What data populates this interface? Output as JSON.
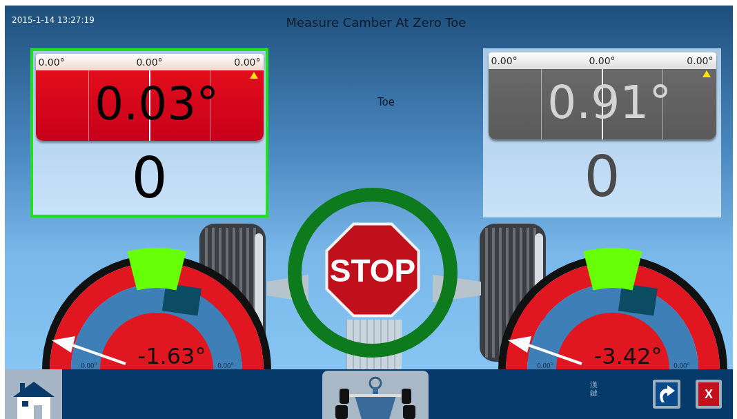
{
  "timestamp": "2015-1-14 13:27:19",
  "title": "Measure Camber At Zero Toe",
  "center_label": "Toe",
  "toe_panels": [
    {
      "selected": true,
      "active": true,
      "scale": [
        "0.00°",
        "0.00°",
        "0.00°"
      ],
      "reading": "0.03°",
      "count": "0"
    },
    {
      "selected": false,
      "active": false,
      "scale": [
        "0.00°",
        "0.00°",
        "0.00°"
      ],
      "reading": "0.91°",
      "count": "0"
    }
  ],
  "camber_gauges": [
    {
      "reading": "-1.63°",
      "scale_left": "0.00°",
      "scale_right": "0.00°"
    },
    {
      "reading": "-3.42°",
      "scale_left": "0.00°",
      "scale_right": "0.00°"
    }
  ],
  "stop_sign": "STOP",
  "bottom_bar": {
    "input_mode": "漢鍵",
    "close_label": "X"
  }
}
